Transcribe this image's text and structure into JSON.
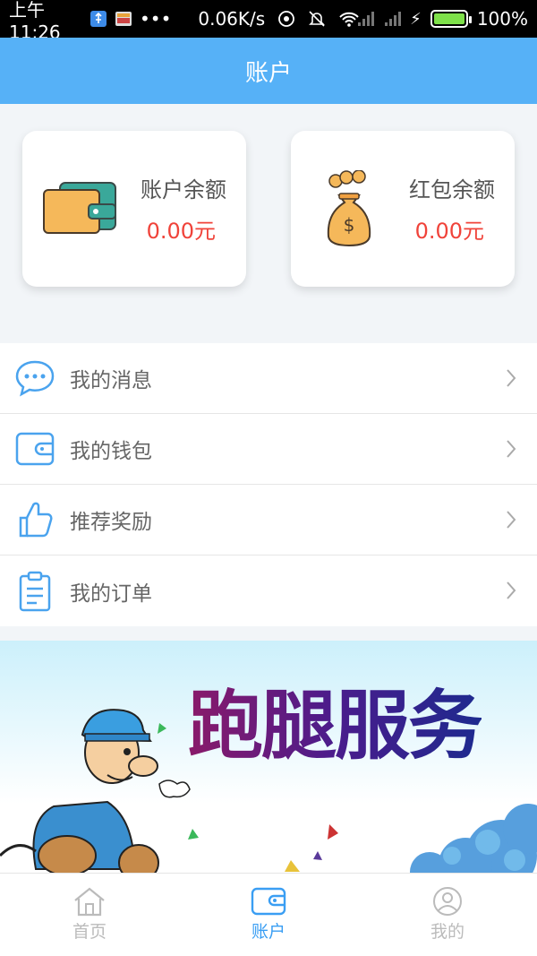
{
  "status_bar": {
    "time": "上午11:26",
    "speed": "0.06K/s",
    "battery": "100%",
    "battery_level": 1.0
  },
  "header": {
    "title": "账户"
  },
  "cards": [
    {
      "title": "账户余额",
      "amount": "0.00元",
      "icon": "wallet-icon"
    },
    {
      "title": "红包余额",
      "amount": "0.00元",
      "icon": "money-bag-icon"
    }
  ],
  "menu": [
    {
      "label": "我的消息",
      "icon": "message-icon"
    },
    {
      "label": "我的钱包",
      "icon": "wallet-outline-icon"
    },
    {
      "label": "推荐奖励",
      "icon": "thumbs-up-icon"
    },
    {
      "label": "我的订单",
      "icon": "clipboard-icon"
    }
  ],
  "banner": {
    "title": "跑腿服务"
  },
  "bottom_nav": [
    {
      "label": "首页",
      "icon": "home-icon",
      "active": false
    },
    {
      "label": "账户",
      "icon": "wallet-icon",
      "active": true
    },
    {
      "label": "我的",
      "icon": "user-icon",
      "active": false
    }
  ],
  "colors": {
    "primary": "#56b1f7",
    "amount": "#f0433a",
    "icon_blue": "#4aa3ee",
    "active_nav": "#3a9ef3",
    "inactive_nav": "#bbbbbb"
  }
}
